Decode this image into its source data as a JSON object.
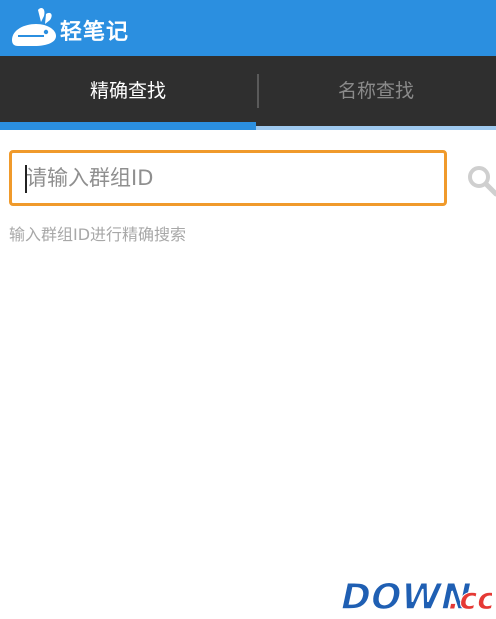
{
  "app": {
    "title": "轻笔记"
  },
  "tabs": [
    {
      "label": "精确查找",
      "active": true
    },
    {
      "label": "名称查找",
      "active": false
    }
  ],
  "search": {
    "placeholder": "请输入群组ID",
    "value": "",
    "hint": "输入群组ID进行精确搜索"
  },
  "watermark": {
    "text_main": "DOWN",
    "text_suffix": ".cc"
  },
  "colors": {
    "accent": "#2b8fe0",
    "tabbar": "#2f2f2f",
    "input_border": "#f09a2b",
    "hint_text": "#a8a8a8"
  },
  "icons": {
    "logo": "rabbit-logo-icon",
    "search": "search-icon"
  }
}
